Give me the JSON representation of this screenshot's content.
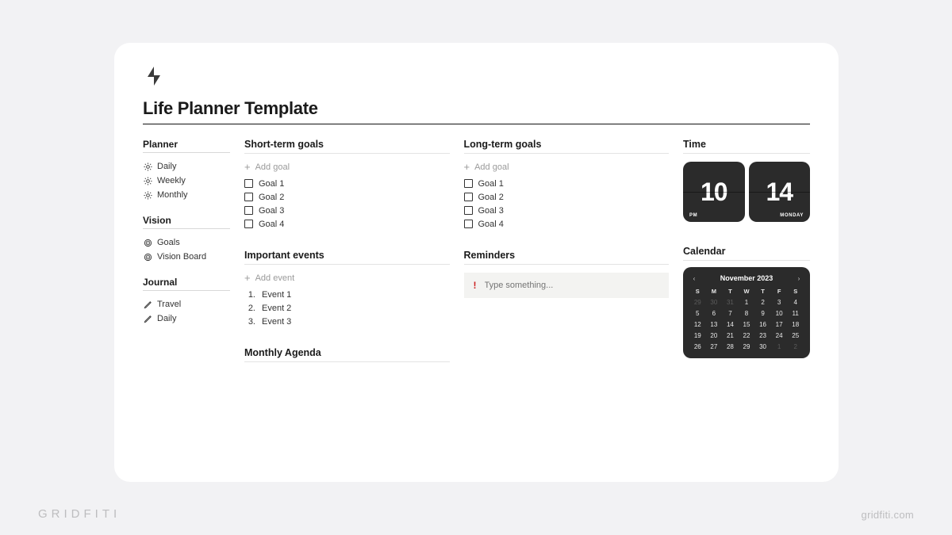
{
  "page": {
    "title": "Life Planner Template"
  },
  "sidebar": {
    "sections": [
      {
        "heading": "Planner",
        "items": [
          {
            "label": "Daily",
            "icon": "sun"
          },
          {
            "label": "Weekly",
            "icon": "sun"
          },
          {
            "label": "Monthly",
            "icon": "sun"
          }
        ]
      },
      {
        "heading": "Vision",
        "items": [
          {
            "label": "Goals",
            "icon": "target"
          },
          {
            "label": "Vision Board",
            "icon": "target"
          }
        ]
      },
      {
        "heading": "Journal",
        "items": [
          {
            "label": "Travel",
            "icon": "pen"
          },
          {
            "label": "Daily",
            "icon": "pen"
          }
        ]
      }
    ]
  },
  "short_goals": {
    "heading": "Short-term goals",
    "add_label": "Add goal",
    "items": [
      "Goal 1",
      "Goal 2",
      "Goal 3",
      "Goal 4"
    ]
  },
  "long_goals": {
    "heading": "Long-term goals",
    "add_label": "Add goal",
    "items": [
      "Goal 1",
      "Goal 2",
      "Goal 3",
      "Goal 4"
    ]
  },
  "events": {
    "heading": "Important events",
    "add_label": "Add event",
    "items": [
      "Event 1",
      "Event 2",
      "Event 3"
    ]
  },
  "reminders": {
    "heading": "Reminders",
    "placeholder": "Type something..."
  },
  "agenda": {
    "heading": "Monthly Agenda"
  },
  "time": {
    "heading": "Time",
    "hour": "10",
    "minute": "14",
    "ampm": "PM",
    "dow": "MONDAY"
  },
  "calendar": {
    "heading": "Calendar",
    "month_label": "November 2023",
    "dow": [
      "S",
      "M",
      "T",
      "W",
      "T",
      "F",
      "S"
    ],
    "leading_mute": [
      "29",
      "30",
      "31"
    ],
    "days": [
      "1",
      "2",
      "3",
      "4",
      "5",
      "6",
      "7",
      "8",
      "9",
      "10",
      "11",
      "12",
      "13",
      "14",
      "15",
      "16",
      "17",
      "18",
      "19",
      "20",
      "21",
      "22",
      "23",
      "24",
      "25",
      "26",
      "27",
      "28",
      "29",
      "30"
    ],
    "trailing_mute": [
      "1",
      "2"
    ]
  },
  "watermark": {
    "left": "GRIDFITI",
    "right": "gridfiti.com"
  }
}
